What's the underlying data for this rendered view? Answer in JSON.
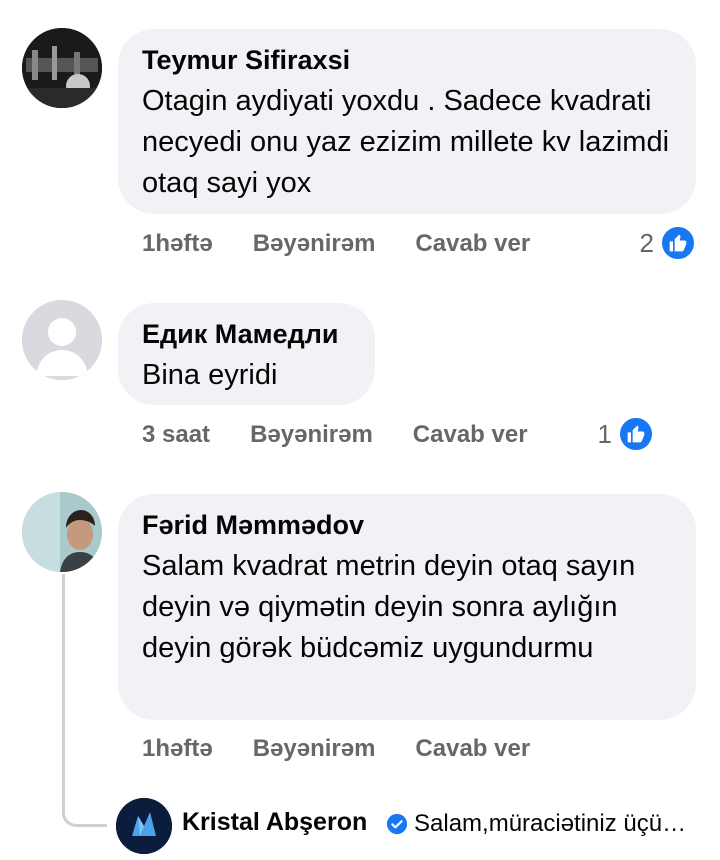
{
  "comments": [
    {
      "author": "Teymur Sifiraxsi",
      "text": "Otagin aydiyati yoxdu . Sadece kvadrati necyedi onu yaz ezizim millete kv lazimdi  otaq sayi yox",
      "time": "1həftə",
      "like": "Bəyənirəm",
      "reply": "Cavab ver",
      "reactions": "2"
    },
    {
      "author": "Едик Мамедли",
      "text": "Bina eyridi",
      "time": "3 saat",
      "like": "Bəyənirəm",
      "reply": "Cavab ver",
      "reactions": "1"
    },
    {
      "author": "Fərid Məmmədov",
      "text": "Salam kvadrat metrin deyin otaq sayın deyin və qiymətin deyin sonra aylığın deyin görək büdcəmiz uygundurmu",
      "time": "1həftə",
      "like": "Bəyənirəm",
      "reply": "Cavab ver"
    }
  ],
  "reply": {
    "author": "Kristal Abşeron",
    "text": "Salam,müraciətiniz üçü…"
  },
  "colors": {
    "like_blue": "#1877f2",
    "bubble": "#f0f2f5",
    "meta": "#65676b"
  }
}
